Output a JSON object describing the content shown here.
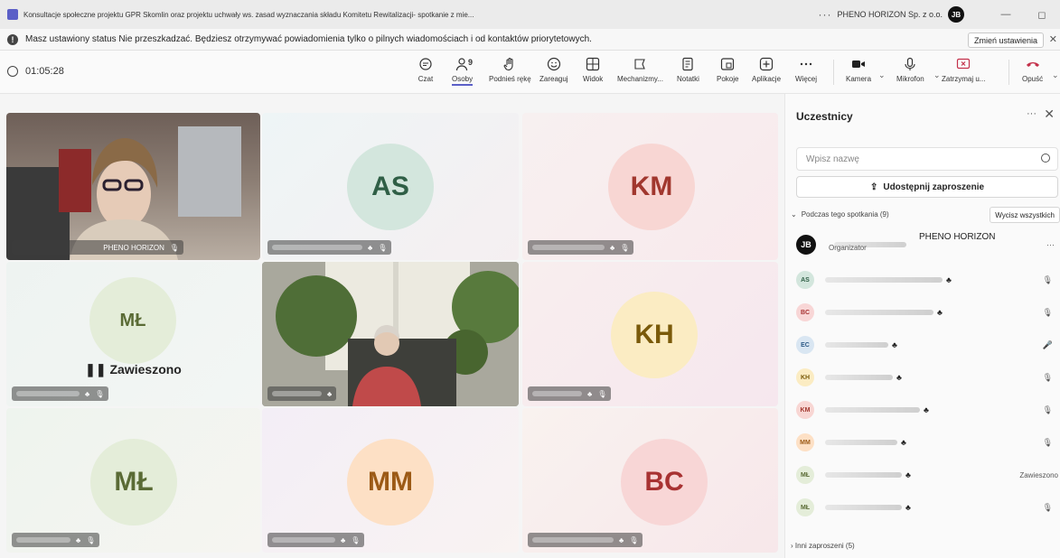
{
  "window": {
    "title": "Konsultacje społeczne projektu GPR Skomlin oraz projektu uchwały ws. zasad wyznaczania składu Komitetu Rewitalizacji- spotkanie z mie...",
    "more": "···",
    "org": "PHENO HORIZON Sp. z o.o.",
    "avatar": "JB",
    "minimize": "—",
    "restore": "◻"
  },
  "banner": {
    "text": "Masz ustawiony status Nie przeszkadzać. Będziesz otrzymywać powiadomienia tylko o pilnych wiadomościach i od kontaktów priorytetowych.",
    "button": "Zmień ustawienia",
    "close": "✕"
  },
  "toolbar": {
    "timer": "01:05:28",
    "people_count": "9",
    "items": {
      "chat": "Czat",
      "people": "Osoby",
      "raise": "Podnieś rękę",
      "react": "Zareaguj",
      "view": "Widok",
      "mech": "Mechanizmy...",
      "notes": "Notatki",
      "rooms": "Pokoje",
      "apps": "Aplikacje",
      "more": "Więcej",
      "camera": "Kamera",
      "mic": "Mikrofon",
      "stop": "Zatrzymaj u...",
      "leave": "Opuść"
    }
  },
  "tiles": {
    "t1_name": "PHENO HORIZON",
    "t2": "AS",
    "t3": "KM",
    "t4": "MŁ",
    "t4_status": "Zawieszono",
    "t6": "KH",
    "t7": "MŁ",
    "t8": "MM",
    "t9": "BC"
  },
  "panel": {
    "title": "Uczestnicy",
    "more": "···",
    "close": "✕",
    "search_placeholder": "Wpisz nazwę",
    "share": "Udostępnij zaproszenie",
    "section": "Podczas tego spotkania (9)",
    "mute_all": "Wycisz wszystkich",
    "organizer_initials": "JB",
    "organizer_name": "PHENO HORIZON",
    "organizer_role": "Organizator",
    "organizer_more": "···",
    "participants": [
      "AS",
      "BC",
      "EC",
      "KH",
      "KM",
      "MM",
      "MŁ",
      "MŁ"
    ],
    "suspended_label": "Zawieszono",
    "others": "Inni zaproszeni (5)"
  },
  "colors": {
    "accent": "#5b5fc7",
    "leave": "#c4314b"
  }
}
